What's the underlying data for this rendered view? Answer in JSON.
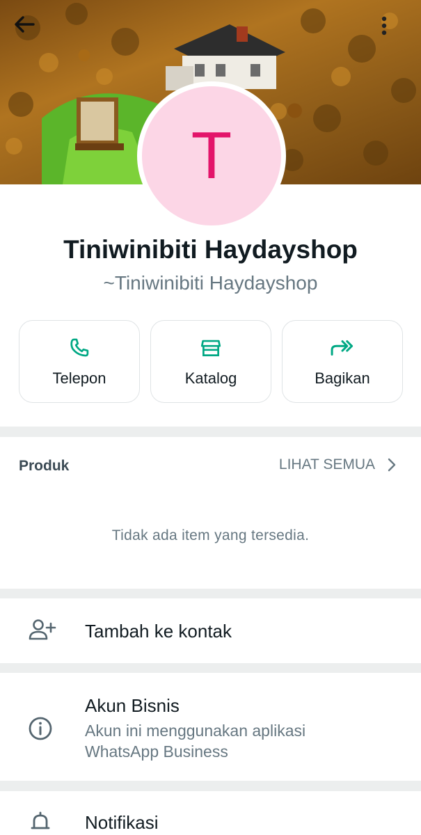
{
  "profile": {
    "initial": "T",
    "name": "Tiniwinibiti Haydayshop",
    "push_name": "~Tiniwinibiti Haydayshop"
  },
  "actions": [
    {
      "label": "Telepon",
      "icon": "phone-icon"
    },
    {
      "label": "Katalog",
      "icon": "storefront-icon"
    },
    {
      "label": "Bagikan",
      "icon": "forward-icon"
    }
  ],
  "products": {
    "title": "Produk",
    "see_all": "LIHAT SEMUA",
    "empty_text": "Tidak ada item yang tersedia."
  },
  "add_contact": {
    "label": "Tambah ke kontak",
    "icon": "add-person-icon"
  },
  "business": {
    "title": "Akun Bisnis",
    "description": "Akun ini menggunakan aplikasi WhatsApp Business",
    "icon": "info-icon"
  },
  "notifications": {
    "label": "Notifikasi",
    "icon": "bell-icon"
  },
  "colors": {
    "accent": "#00a884",
    "avatar_bg": "#fcd6e6",
    "avatar_text": "#e3146a"
  }
}
